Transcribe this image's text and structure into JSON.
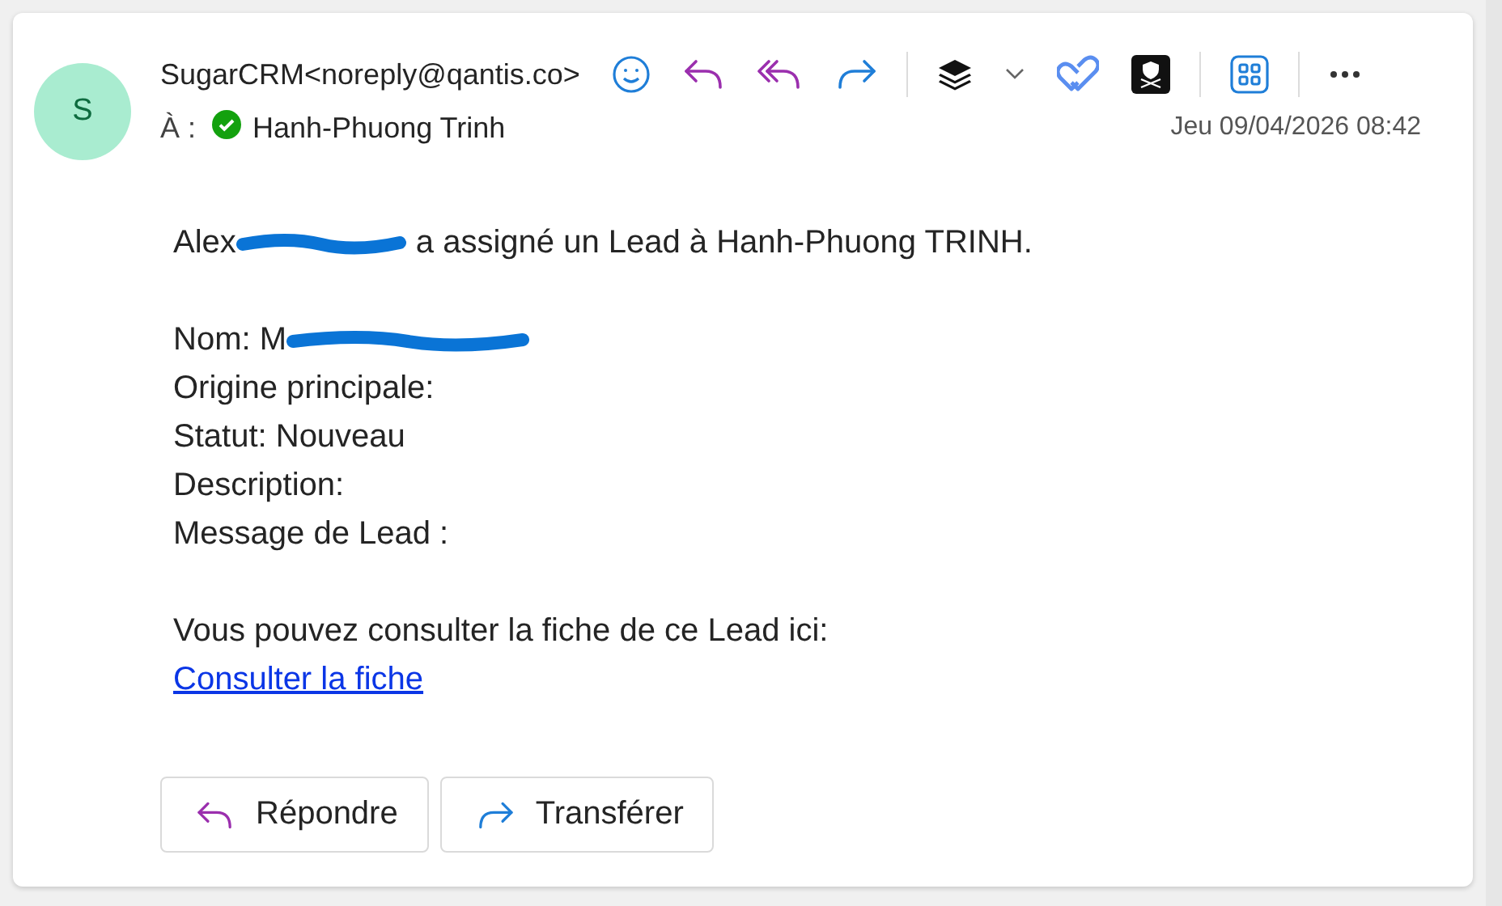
{
  "sender": {
    "initial": "S",
    "name": "SugarCRM<noreply@qantis.co>"
  },
  "recipient": {
    "label": "À :",
    "name": "Hanh-Phuong Trinh",
    "verified": true
  },
  "date": "Jeu 09/04/2026 08:42",
  "body": {
    "paragraphs": [
      [
        {
          "before": "Alex",
          "redacted": true,
          "after": "a assigné un Lead à Hanh-Phuong TRINH."
        }
      ],
      [
        {
          "before": "Nom: M",
          "redacted": true
        },
        {
          "before": "Origine principale:"
        },
        {
          "before": "Statut: Nouveau"
        },
        {
          "before": "Description:"
        },
        {
          "before": "Message de Lead :"
        }
      ],
      [
        {
          "before": "Vous pouvez consulter la fiche de ce Lead ici:"
        }
      ]
    ],
    "link": "Consulter la fiche"
  },
  "actions": [
    {
      "kind": "reply",
      "label": "Répondre"
    },
    {
      "kind": "forward",
      "label": "Transférer"
    }
  ]
}
